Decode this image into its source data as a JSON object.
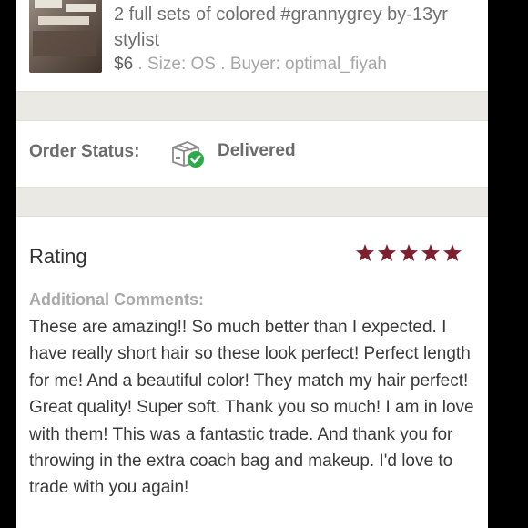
{
  "product": {
    "title": "2 full sets of colored #grannygrey by-13yr stylist",
    "price": "$6",
    "separator1": " . ",
    "size": "Size: OS",
    "separator2": " . ",
    "buyer": "Buyer: optimal_fiyah"
  },
  "order": {
    "status_label": "Order Status:",
    "status_value": "Delivered",
    "status_icon": "box-delivered-check-icon"
  },
  "rating": {
    "title": "Rating",
    "stars": 5,
    "stars_max": 5,
    "star_color": "#7d1f2f",
    "comments_label": "Additional Comments:",
    "comments": "These are amazing!! So much better than I expected. I have really short hair so these look perfect! Perfect length for me! And a beautiful color! They match my hair perfect! Great quality! Super soft. Thank you so much! I am in love with them! This was a fantastic trade. And thank you for throwing in the extra coach bag and makeup. I'd love to trade with you again!"
  },
  "colors": {
    "check_green": "#2eaa4a",
    "star": "#7d1f2f"
  }
}
